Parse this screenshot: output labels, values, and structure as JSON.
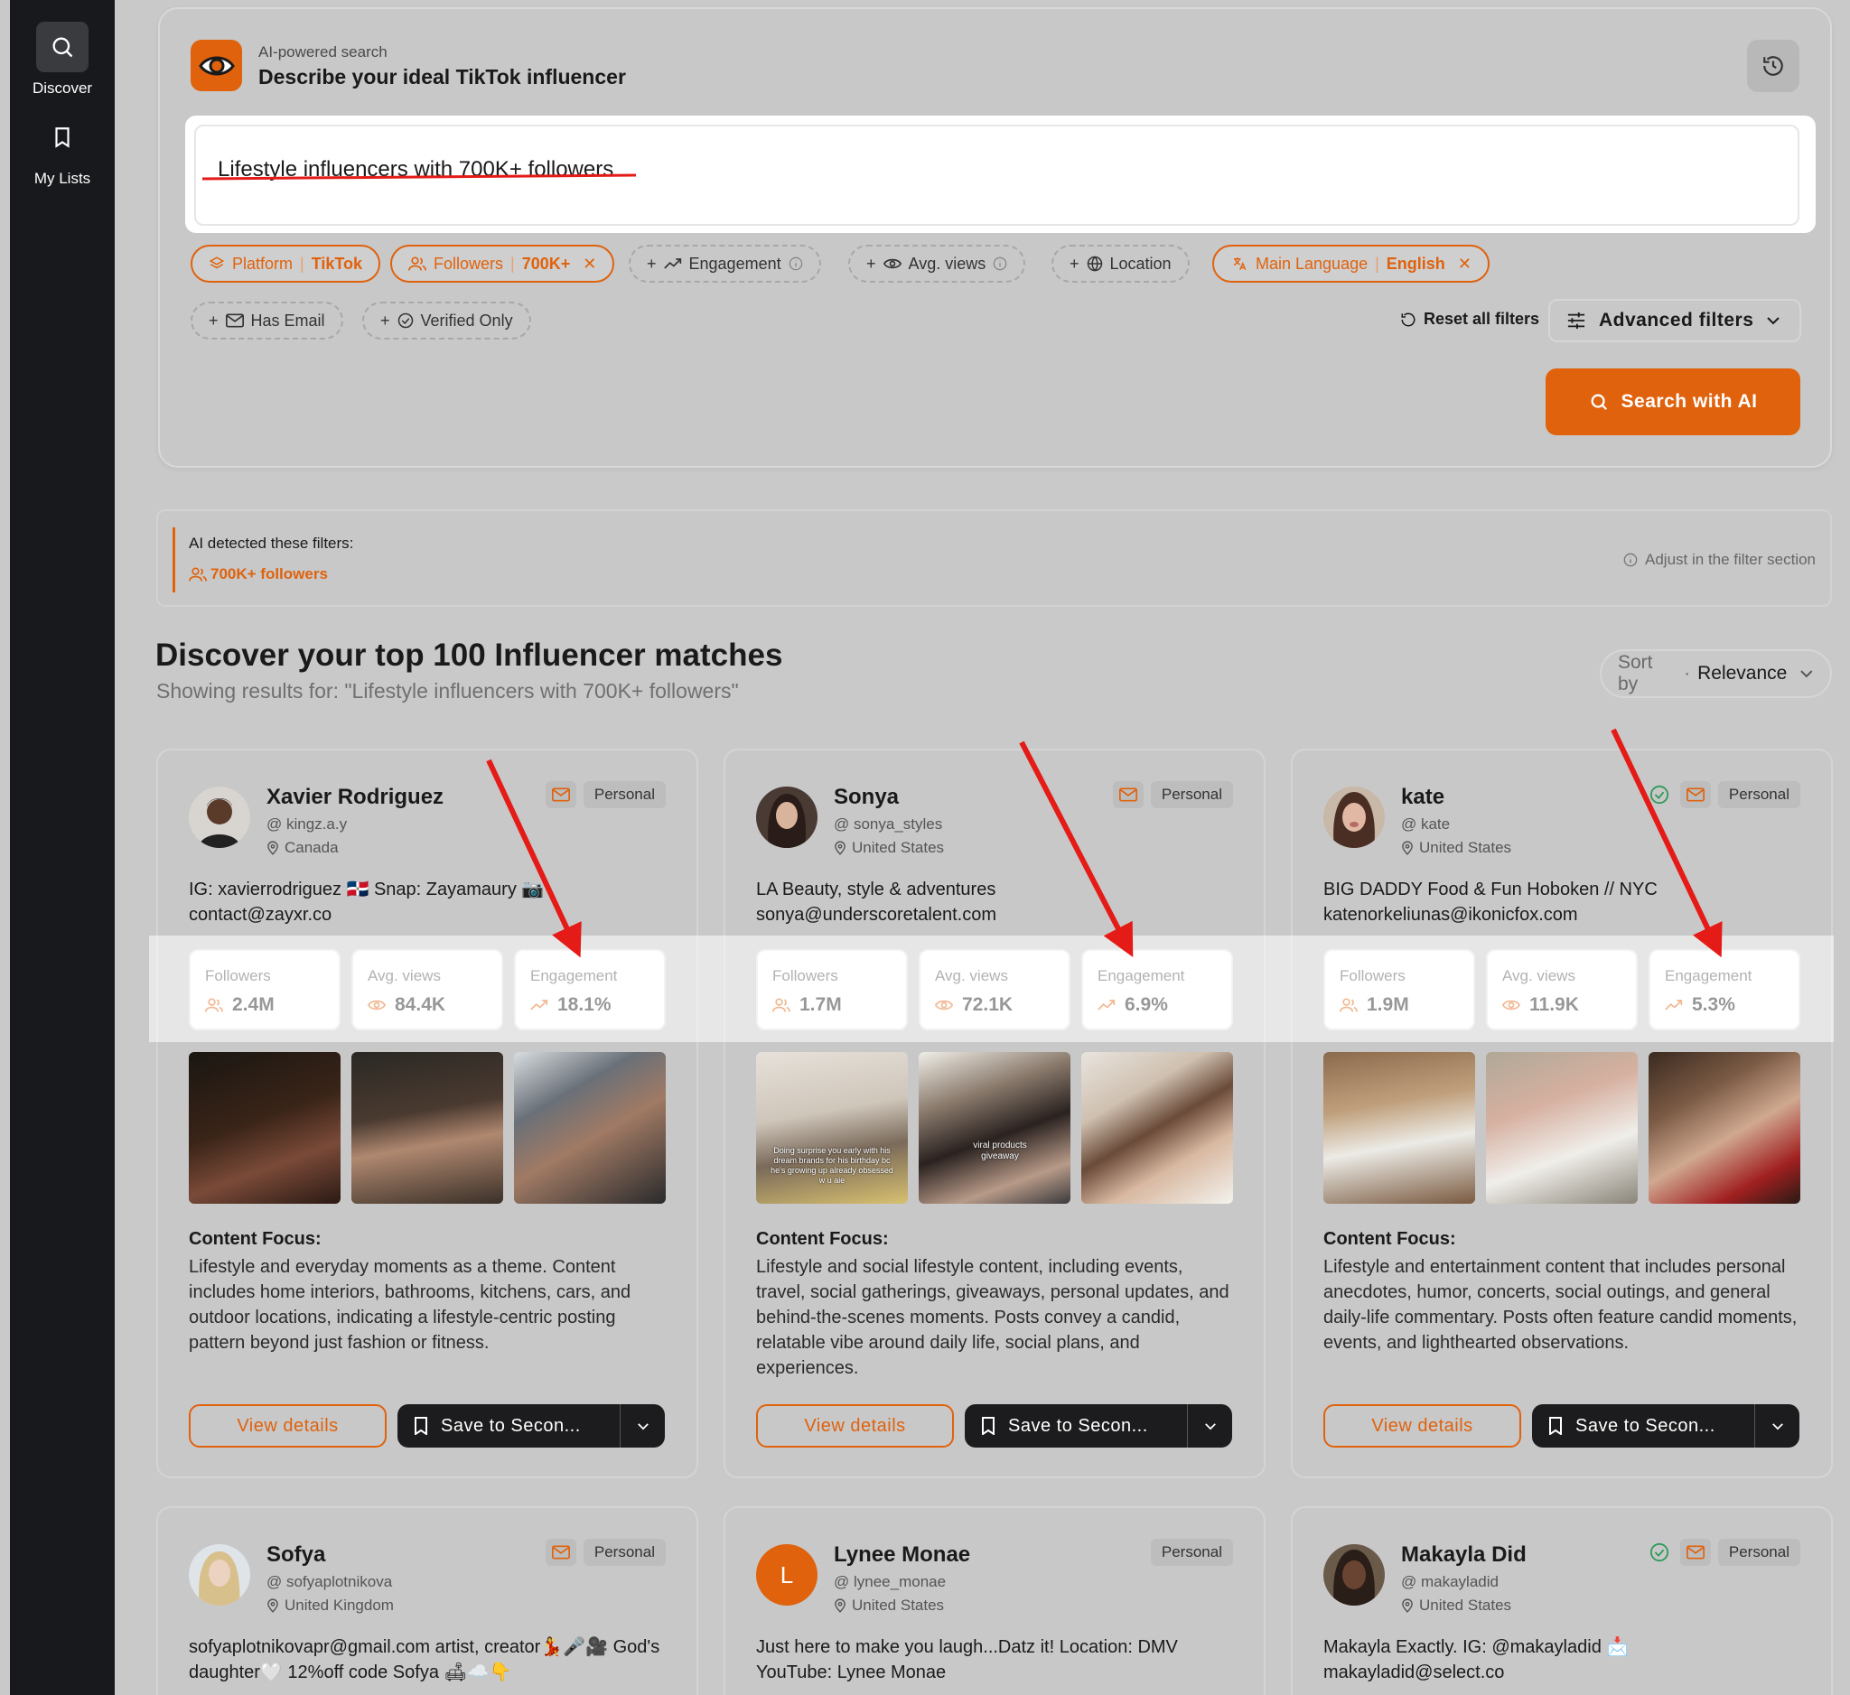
{
  "sidebar": {
    "items": [
      {
        "label": "Discover",
        "icon": "search-icon",
        "active": true
      },
      {
        "label": "My Lists",
        "icon": "bookmark-icon",
        "active": false
      }
    ]
  },
  "search": {
    "subtitle": "AI-powered search",
    "title": "Describe your ideal TikTok influencer",
    "query": "Lifestyle influencers with 700K+ followers",
    "chips": {
      "platform": {
        "label": "Platform",
        "value": "TikTok"
      },
      "followers": {
        "label": "Followers",
        "value": "700K+"
      },
      "engagement": {
        "label": "Engagement"
      },
      "avg_views": {
        "label": "Avg. views"
      },
      "location": {
        "label": "Location"
      },
      "language": {
        "label": "Main Language",
        "value": "English"
      },
      "has_email": {
        "label": "Has Email"
      },
      "verified": {
        "label": "Verified Only"
      }
    },
    "reset_label": "Reset all filters",
    "advanced_label": "Advanced filters",
    "search_button": "Search with AI",
    "accent": "#e0620d"
  },
  "detected": {
    "label": "AI detected these filters:",
    "tag": "700K+ followers",
    "adjust": "Adjust in the filter section"
  },
  "results": {
    "title": "Discover your top 100 Influencer matches",
    "subtitle": "Showing results for: \"Lifestyle influencers with 700K+ followers\"",
    "sort_key": "Sort by",
    "sort_dot": "·",
    "sort_value": "Relevance"
  },
  "labels": {
    "personal": "Personal",
    "followers": "Followers",
    "avg_views": "Avg. views",
    "engagement": "Engagement",
    "content_focus": "Content Focus:",
    "view_details": "View details",
    "save": "Save to Secon..."
  },
  "cards": [
    {
      "name": "Xavier Rodriguez",
      "handle": "@ kingz.a.y",
      "location": "Canada",
      "bio": "IG: xavierrodriguez 🇩🇴 Snap: Zayamaury 📷 contact@zayxr.co",
      "followers": "2.4M",
      "avg_views": "84.4K",
      "engagement": "18.1%",
      "content_focus": "Lifestyle and everyday moments as a theme. Content includes home interiors, bathrooms, kitchens, cars, and outdoor locations, indicating a lifestyle-centric posting pattern beyond just fashion or fitness."
    },
    {
      "name": "Sonya",
      "handle": "@ sonya_styles",
      "location": "United States",
      "bio": "LA Beauty, style & adventures sonya@underscoretalent.com",
      "followers": "1.7M",
      "avg_views": "72.1K",
      "engagement": "6.9%",
      "content_focus": "Lifestyle and social lifestyle content, including events, travel, social gatherings, giveaways, personal updates, and behind-the-scenes moments. Posts convey a candid, relatable vibe around daily life, social plans, and experiences."
    },
    {
      "name": "kate",
      "handle": "@ kate",
      "location": "United States",
      "bio": "BIG DADDY Food & Fun Hoboken // NYC katenorkeliunas@ikonicfox.com",
      "followers": "1.9M",
      "avg_views": "11.9K",
      "engagement": "5.3%",
      "content_focus": "Lifestyle and entertainment content that includes personal anecdotes, humor, concerts, social outings, and general daily-life commentary. Posts often feature candid moments, events, and lighthearted observations."
    },
    {
      "name": "Sofya",
      "handle": "@ sofyaplotnikova",
      "location": "United Kingdom",
      "bio": "sofyaplotnikovapr@gmail.com artist, creator💃🎤🎥 God's daughter🤍 12%off code Sofya 🛋☁️👇"
    },
    {
      "name": "Lynee Monae",
      "handle": "@ lynee_monae",
      "location": "United States",
      "avatar_letter": "L",
      "bio": "Just here to make you laugh...Datz it! Location: DMV YouTube: Lynee Monae"
    },
    {
      "name": "Makayla Did",
      "handle": "@ makayladid",
      "location": "United States",
      "bio": "Makayla Exactly. IG: @makayladid 📩 makayladid@select.co"
    }
  ],
  "thumb_captions": {
    "sonya_1": "Doing surprise you early with his dream brands for his birthday bc he's growing up already obsessed w u aie",
    "sonya_2": "viral products giveaway"
  }
}
